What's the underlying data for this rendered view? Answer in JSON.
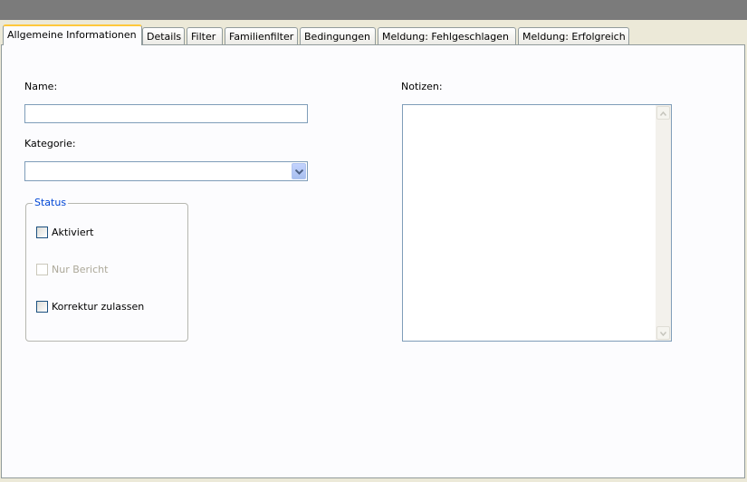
{
  "tabs": [
    {
      "label": "Allgemeine Informationen",
      "active": true
    },
    {
      "label": "Details",
      "active": false
    },
    {
      "label": "Filter",
      "active": false
    },
    {
      "label": "Familienfilter",
      "active": false
    },
    {
      "label": "Bedingungen",
      "active": false
    },
    {
      "label": "Meldung: Fehlgeschlagen",
      "active": false
    },
    {
      "label": "Meldung: Erfolgreich",
      "active": false
    }
  ],
  "form": {
    "name_label": "Name:",
    "name_value": "",
    "category_label": "Kategorie:",
    "category_value": "",
    "status_group_title": "Status",
    "checkboxes": [
      {
        "label": "Aktiviert",
        "checked": false,
        "enabled": true
      },
      {
        "label": "Nur Bericht",
        "checked": false,
        "enabled": false
      },
      {
        "label": "Korrektur zulassen",
        "checked": false,
        "enabled": true
      }
    ],
    "notes_label": "Notizen:",
    "notes_value": ""
  },
  "icons": {
    "combo_arrow": "chevron-down-icon",
    "scroll_up": "scroll-up-arrow-icon",
    "scroll_down": "scroll-down-arrow-icon"
  },
  "colors": {
    "titlebar": "#7b7b7b",
    "active_tab_highlight": "#ffc83c",
    "group_title": "#0046d5",
    "field_border": "#7f9db9"
  }
}
